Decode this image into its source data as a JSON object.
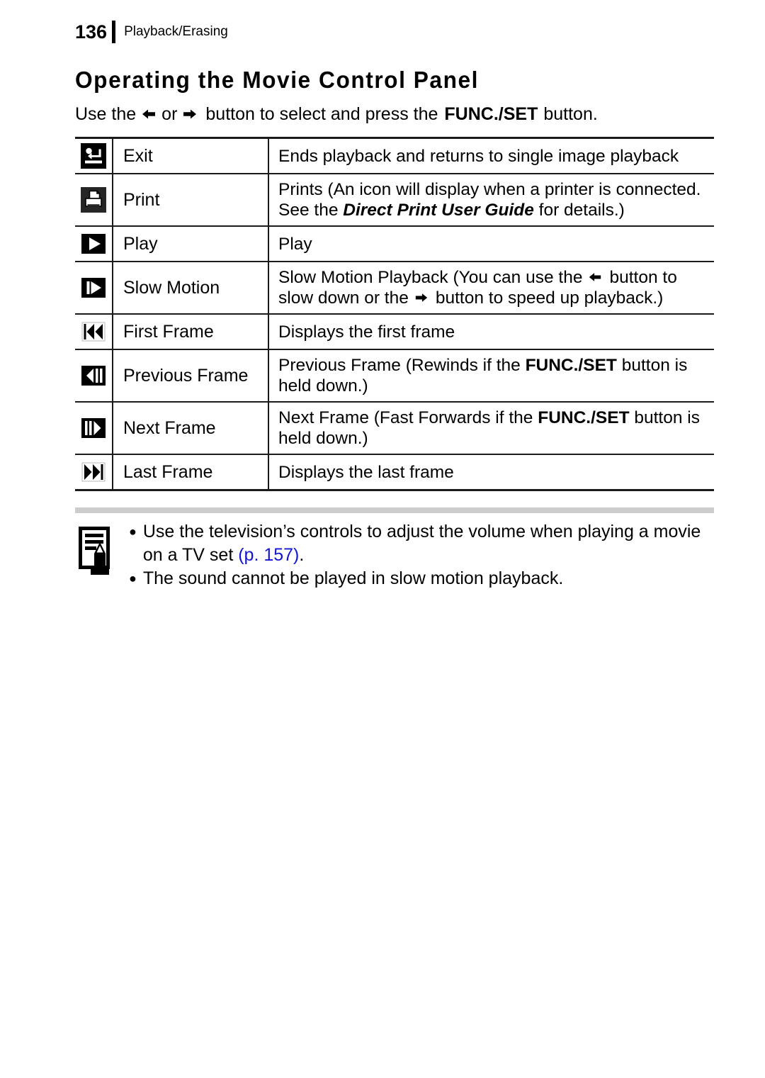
{
  "header": {
    "page_number": "136",
    "section": "Playback/Erasing"
  },
  "title": "Operating the Movie Control Panel",
  "intro": {
    "part1": "Use the",
    "icon_left": "arrow-left-icon",
    "part2": "or",
    "icon_right": "arrow-right-icon",
    "part3": "button to select and press the",
    "bold": "FUNC./SET",
    "part4": "button."
  },
  "table": {
    "rows": [
      {
        "icon": "exit-return-icon",
        "name": "Exit",
        "desc": "Ends playback and returns to single image playback"
      },
      {
        "icon": "print-icon",
        "name": "Print",
        "desc_a": "Prints (An icon will display when a printer is connected. See the ",
        "desc_italic": "Direct Print User Guide",
        "desc_b": " for details.)"
      },
      {
        "icon": "play-icon",
        "name": "Play",
        "desc": "Play"
      },
      {
        "icon": "slow-motion-icon",
        "name": "Slow Motion",
        "desc_a": "Slow Motion Playback (You can use the",
        "desc_b": "button to slow down or the",
        "desc_c": "button to speed up playback.)"
      },
      {
        "icon": "first-frame-icon",
        "name": "First Frame",
        "desc": "Displays the first frame"
      },
      {
        "icon": "previous-frame-icon",
        "name": "Previous Frame",
        "desc_a": "Previous Frame (Rewinds if the ",
        "desc_bold": "FUNC./SET",
        "desc_b": " button is held down.)"
      },
      {
        "icon": "next-frame-icon",
        "name": "Next Frame",
        "desc_a": "Next Frame (Fast Forwards if the ",
        "desc_bold": "FUNC./SET",
        "desc_b": " button is held down.)"
      },
      {
        "icon": "last-frame-icon",
        "name": "Last Frame",
        "desc": "Displays the last frame"
      }
    ]
  },
  "note": {
    "icon": "memo-note-icon",
    "bullet": "●",
    "items": [
      {
        "text_a": "Use the television’s controls to adjust the volume when playing a movie on a TV set ",
        "page_ref": "(p. 157)",
        "text_b": "."
      },
      {
        "text_a": "The sound cannot be played in slow motion playback.",
        "page_ref": "",
        "text_b": ""
      }
    ]
  },
  "colors": {
    "link": "#1414d2",
    "rule": "#1a1a1a",
    "gray_bar": "#cccccc"
  }
}
